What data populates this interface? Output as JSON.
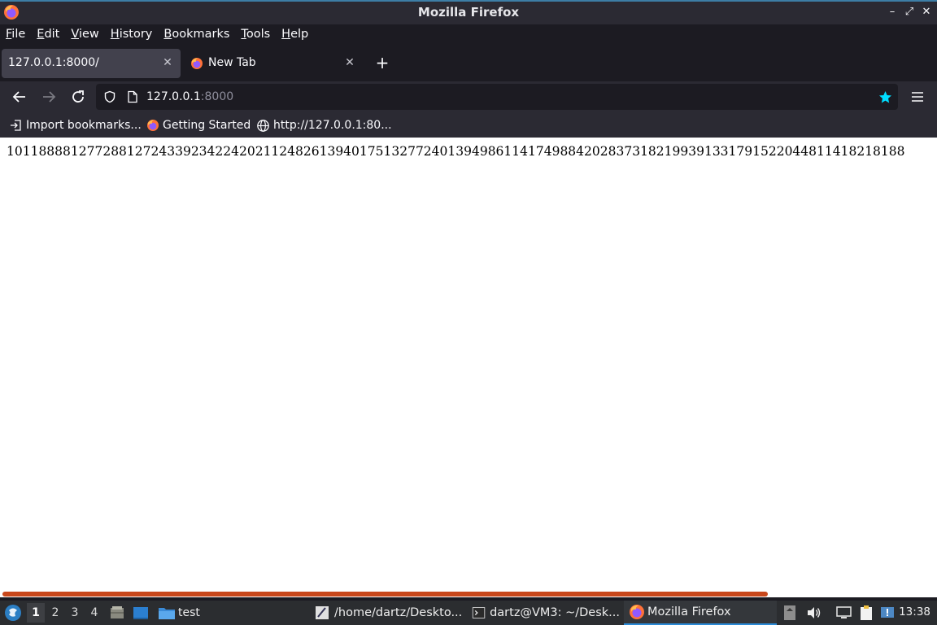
{
  "window": {
    "title": "Mozilla Firefox"
  },
  "menu": [
    {
      "u": "F",
      "rest": "ile"
    },
    {
      "u": "E",
      "rest": "dit"
    },
    {
      "u": "V",
      "rest": "iew"
    },
    {
      "u": "H",
      "rest": "istory"
    },
    {
      "u": "B",
      "rest": "ookmarks"
    },
    {
      "u": "T",
      "rest": "ools"
    },
    {
      "u": "H",
      "rest": "elp"
    }
  ],
  "tabs": [
    {
      "label": "127.0.0.1:8000/",
      "active": true
    },
    {
      "label": "New Tab",
      "active": false
    }
  ],
  "urlbar": {
    "host": "127.0.0.1",
    "port": ":8000"
  },
  "bookmarks": [
    {
      "label": "Import bookmarks...",
      "icon": "import-icon"
    },
    {
      "label": "Getting Started",
      "icon": "firefox-icon"
    },
    {
      "label": "http://127.0.0.1:80...",
      "icon": "globe-icon"
    }
  ],
  "page": {
    "text": "1011888812772881272433923422420211248261394017513277240139498611417498842028373182199391331791522044811418218188"
  },
  "taskbar": {
    "workspaces": [
      "1",
      "2",
      "3",
      "4"
    ],
    "active_workspace": "1",
    "folder_label": "test",
    "tasks": [
      {
        "label": "/home/dartz/Deskto...",
        "icon": "text-editor-icon"
      },
      {
        "label": "dartz@VM3: ~/Desk...",
        "icon": "terminal-icon"
      },
      {
        "label": "Mozilla Firefox",
        "icon": "firefox-icon",
        "active": true
      }
    ],
    "clock": "13:38"
  }
}
